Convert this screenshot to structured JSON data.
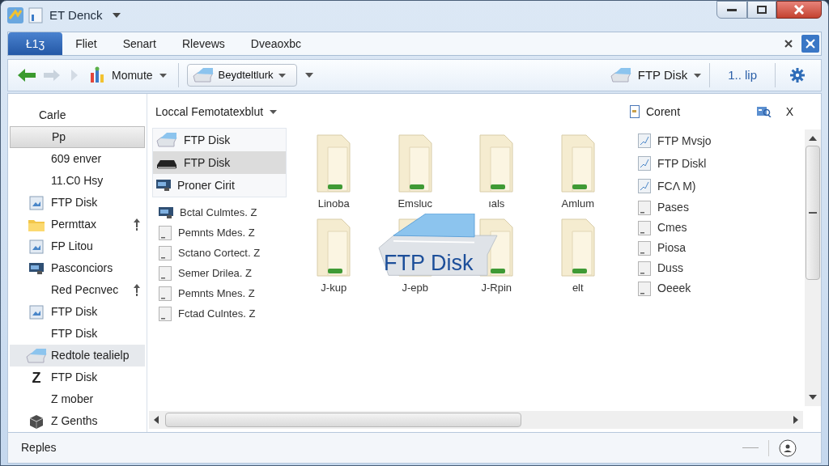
{
  "window": {
    "title": "ET Denck"
  },
  "menu": {
    "tabs": [
      {
        "label": "Ł1ʒ",
        "selected": true
      },
      {
        "label": "Fliet",
        "selected": false
      },
      {
        "label": "Senart",
        "selected": false
      },
      {
        "label": "Rlevews",
        "selected": false
      },
      {
        "label": "Dveaoxbc",
        "selected": false
      }
    ]
  },
  "toolbar": {
    "view_button": "Momute",
    "address": "Beydteltlurk",
    "drive_button": "FTP Disk",
    "link": "1.. lip"
  },
  "sidebar": {
    "heading": "Carle",
    "items": [
      {
        "label": "Pp",
        "kind": "none",
        "selected": true,
        "hovered": false,
        "pinned": false
      },
      {
        "label": "609 enver",
        "kind": "none",
        "selected": false,
        "hovered": false,
        "pinned": false
      },
      {
        "label": "11.C0 Hsy",
        "kind": "none",
        "selected": false,
        "hovered": false,
        "pinned": false
      },
      {
        "label": "FTP Disk",
        "kind": "image",
        "selected": false,
        "hovered": false,
        "pinned": false
      },
      {
        "label": "Permttax",
        "kind": "folder",
        "selected": false,
        "hovered": false,
        "pinned": true
      },
      {
        "label": "FP Litou",
        "kind": "image",
        "selected": false,
        "hovered": false,
        "pinned": false
      },
      {
        "label": "Pasconciors",
        "kind": "monitor",
        "selected": false,
        "hovered": false,
        "pinned": false
      },
      {
        "label": "Red Pecnvec",
        "kind": "none",
        "selected": false,
        "hovered": false,
        "pinned": true
      },
      {
        "label": "FTP Disk",
        "kind": "image",
        "selected": false,
        "hovered": false,
        "pinned": false
      },
      {
        "label": "FTP Disk",
        "kind": "none",
        "selected": false,
        "hovered": false,
        "pinned": false
      },
      {
        "label": "Redtole tealielp",
        "kind": "drive",
        "selected": false,
        "hovered": true,
        "pinned": false
      },
      {
        "label": "FTP Disk",
        "kind": "letter",
        "glyph": "Z",
        "selected": false,
        "hovered": false,
        "pinned": false
      },
      {
        "label": "Z mober",
        "kind": "none",
        "selected": false,
        "hovered": false,
        "pinned": false
      },
      {
        "label": "Z Genths",
        "kind": "box",
        "selected": false,
        "hovered": false,
        "pinned": false
      }
    ]
  },
  "folder_pane": {
    "heading": "Loccal Femotatexblut",
    "top_items": [
      {
        "label": "FTP Disk",
        "kind": "drive",
        "selected": false
      },
      {
        "label": "FTP Disk",
        "kind": "dark-drive",
        "selected": true
      },
      {
        "label": "Proner Cirit",
        "kind": "monitor",
        "selected": false
      }
    ],
    "items": [
      {
        "label": "Bctal Culmtes. Z",
        "kind": "monitor"
      },
      {
        "label": "Pemnts Mdes. Z",
        "kind": "file"
      },
      {
        "label": "Sctano Cortect. Z",
        "kind": "file"
      },
      {
        "label": "Semer Drilea. Z",
        "kind": "file"
      },
      {
        "label": "Pemnts Mnes. Z",
        "kind": "file"
      },
      {
        "label": "Fctad Culntes. Z",
        "kind": "file"
      }
    ]
  },
  "folders": [
    {
      "label": "Linoba"
    },
    {
      "label": "Emsluc"
    },
    {
      "label": "ıals"
    },
    {
      "label": "Amlum"
    },
    {
      "label": "J-kup"
    },
    {
      "label": "J-epb"
    },
    {
      "label": "J-Rpin"
    },
    {
      "label": "elt"
    }
  ],
  "logo": {
    "text": "FTP Disk"
  },
  "details_pane": {
    "heading": "Corent",
    "close_glyph": "X",
    "items": [
      {
        "label": "FTP Mvsjo",
        "kind": "chart"
      },
      {
        "label": "FTP Diskl",
        "kind": "chart"
      },
      {
        "label": "FCΛ M)",
        "kind": "chart"
      },
      {
        "label": "Pases",
        "kind": "file"
      },
      {
        "label": "Cmes",
        "kind": "file"
      },
      {
        "label": "Piosa",
        "kind": "file"
      },
      {
        "label": "Duss",
        "kind": "file"
      },
      {
        "label": "Oeeek",
        "kind": "file"
      }
    ]
  },
  "status_bar": {
    "text": "Reples"
  }
}
